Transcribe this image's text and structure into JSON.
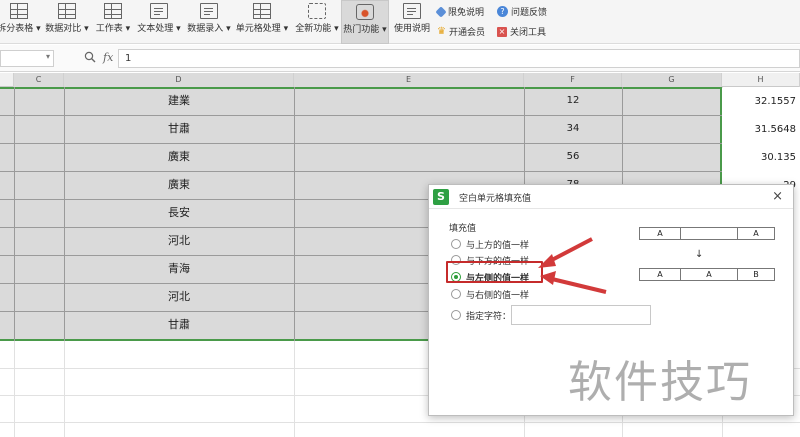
{
  "ribbon": {
    "buttons": [
      {
        "label": "拆分表格 ▾",
        "icon": "split-table-icon"
      },
      {
        "label": "数据对比 ▾",
        "icon": "data-compare-icon"
      },
      {
        "label": "工作表 ▾",
        "icon": "worksheet-icon"
      },
      {
        "label": "文本处理 ▾",
        "icon": "text-process-icon"
      },
      {
        "label": "数据录入 ▾",
        "icon": "data-entry-icon"
      },
      {
        "label": "单元格处理 ▾",
        "icon": "cell-process-icon"
      },
      {
        "label": "全新功能 ▾",
        "icon": "new-feature-icon"
      },
      {
        "label": "热门功能 ▾",
        "icon": "hot-feature-icon"
      },
      {
        "label": "使用说明",
        "icon": "manual-icon"
      }
    ],
    "side_links": [
      {
        "label": "限免说明",
        "icon": "tag-icon"
      },
      {
        "label": "开通会员",
        "icon": "crown-icon"
      },
      {
        "label": "问题反馈",
        "icon": "question-icon"
      },
      {
        "label": "关闭工具",
        "icon": "close-tool-icon"
      }
    ]
  },
  "formula_bar": {
    "name_box": "",
    "fx": "fx",
    "value": "1"
  },
  "columns": [
    "C",
    "D",
    "E",
    "F",
    "G",
    "H"
  ],
  "rows": [
    {
      "d": "建業",
      "f": "12",
      "h": "32.1557"
    },
    {
      "d": "甘肅",
      "f": "34",
      "h": "31.5648"
    },
    {
      "d": "廣東",
      "f": "56",
      "h": "30.135"
    },
    {
      "d": "廣東",
      "f": "78",
      "h": "29"
    },
    {
      "d": "長安",
      "f": "",
      "h": ""
    },
    {
      "d": "河北",
      "f": "",
      "h": ""
    },
    {
      "d": "青海",
      "f": "",
      "h": ""
    },
    {
      "d": "河北",
      "f": "",
      "h": ""
    },
    {
      "d": "甘肅",
      "f": "",
      "h": ""
    }
  ],
  "dialog": {
    "title": "空白单元格填充值",
    "logo": "S",
    "close": "×",
    "section": "填充值",
    "options": [
      {
        "label": "与上方的值一样",
        "selected": false
      },
      {
        "label": "与下方的值一样",
        "selected": false
      },
      {
        "label": "与左侧的值一样",
        "selected": true
      },
      {
        "label": "与右侧的值一样",
        "selected": false
      },
      {
        "label": "指定字符：",
        "selected": false
      }
    ],
    "custom_value": "",
    "example_before": [
      "A",
      "",
      "A"
    ],
    "example_arrow": "↓",
    "example_after": [
      "A",
      "A",
      "B"
    ]
  },
  "watermark": "软件技巧",
  "colors": {
    "accent": "#2e9e3a",
    "selection_border": "#4a9a4a",
    "highlight": "#c52b2b"
  }
}
